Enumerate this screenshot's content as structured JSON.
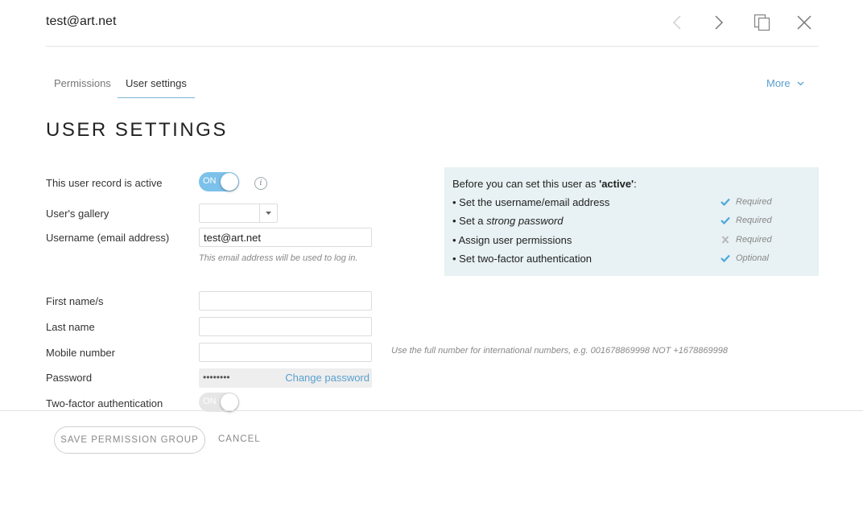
{
  "header": {
    "title": "test@art.net"
  },
  "tabs": [
    {
      "label": "Permissions",
      "active": false
    },
    {
      "label": "User settings",
      "active": true
    }
  ],
  "more_label": "More",
  "page_title": "USER SETTINGS",
  "form": {
    "active": {
      "label": "This user record is active",
      "toggle_text": "ON",
      "state": "on"
    },
    "gallery": {
      "label": "User's gallery",
      "value": ""
    },
    "username": {
      "label": "Username (email address)",
      "value": "test@art.net",
      "hint": "This email address will be used to log in."
    },
    "first_name": {
      "label": "First name/s",
      "value": ""
    },
    "last_name": {
      "label": "Last name",
      "value": ""
    },
    "mobile": {
      "label": "Mobile number",
      "value": "",
      "hint": "Use the full number for international numbers, e.g. 001678869998 NOT +1678869998"
    },
    "password": {
      "label": "Password",
      "masked": "••••••••",
      "change_label": "Change password"
    },
    "two_factor": {
      "label": "Two-factor authentication",
      "toggle_text": "ON",
      "state": "off"
    }
  },
  "requirements": {
    "title_prefix": "Before you can set this user as ",
    "title_bold": "'active'",
    "title_suffix": ":",
    "items": [
      {
        "bullet": "• ",
        "text": "Set the username/email address",
        "italic": "",
        "status": "Required",
        "icon": "check-icon",
        "met": true
      },
      {
        "bullet": "• ",
        "text": "Set a ",
        "italic": "strong password",
        "status": "Required",
        "icon": "check-icon",
        "met": true
      },
      {
        "bullet": "• ",
        "text": "Assign user permissions",
        "italic": "",
        "status": "Required",
        "icon": "cross-icon",
        "met": false
      },
      {
        "bullet": "• ",
        "text": "Set two-factor authentication",
        "italic": "",
        "status": "Optional",
        "icon": "check-icon",
        "met": true
      }
    ]
  },
  "footer": {
    "save_label": "SAVE PERMISSION GROUP",
    "cancel_label": "CANCEL"
  },
  "colors": {
    "accent": "#5aa0cf",
    "toggle_on": "#7cc1ea",
    "check": "#4aa8dc",
    "cross": "#b8b8b8",
    "panel_bg": "#e8f1f3"
  }
}
